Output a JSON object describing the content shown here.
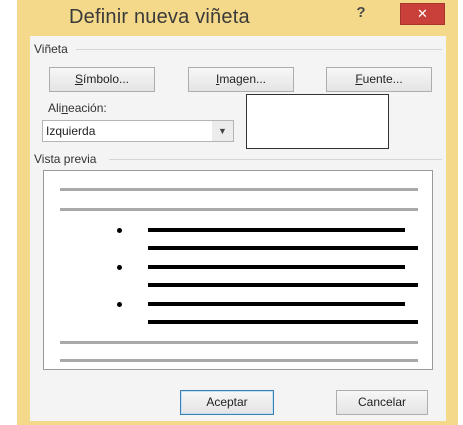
{
  "window": {
    "title": "Definir nueva viñeta",
    "help": "?",
    "close": "✕"
  },
  "bullet_group": {
    "label": "Viñeta",
    "symbol_button": {
      "mnemonic": "S",
      "rest": "ímbolo..."
    },
    "image_button": {
      "mnemonic": "I",
      "rest": "magen..."
    },
    "font_button": {
      "mnemonic": "F",
      "rest": "uente..."
    }
  },
  "alignment": {
    "label_pre": "Ali",
    "label_mnemonic": "n",
    "label_post": "eación:",
    "value": "Izquierda",
    "arrow": "▼"
  },
  "preview": {
    "label": "Vista previa"
  },
  "footer": {
    "accept": "Aceptar",
    "cancel": "Cancelar"
  }
}
